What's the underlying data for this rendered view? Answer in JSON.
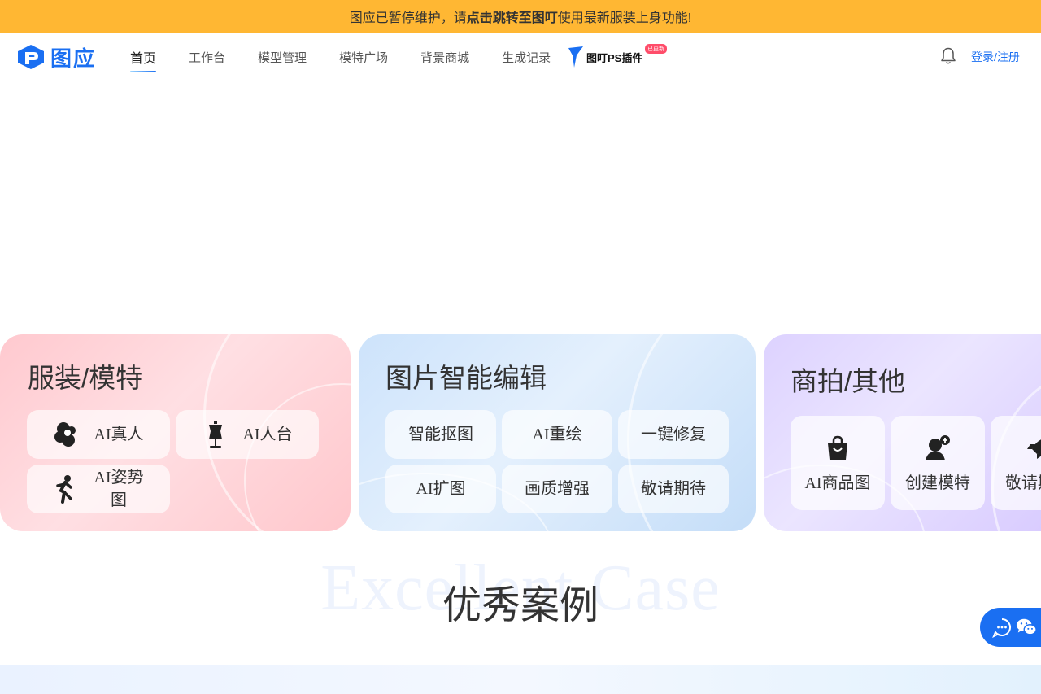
{
  "banner": {
    "text_before": "图应已暂停维护，请",
    "link_text": "点击跳转至图叮",
    "text_after": "使用最新服装上身功能!"
  },
  "header": {
    "logo_text": "图应",
    "nav": [
      {
        "label": "首页",
        "active": true
      },
      {
        "label": "工作台"
      },
      {
        "label": "模型管理"
      },
      {
        "label": "模特广场"
      },
      {
        "label": "背景商城"
      },
      {
        "label": "生成记录"
      }
    ],
    "plugin_label": "图叮PS插件",
    "plugin_badge": "已更新",
    "login_label": "登录/注册",
    "bell_icon": "bell-icon"
  },
  "cards": {
    "apparel": {
      "title": "服装/模特",
      "items": [
        {
          "label": "AI真人",
          "icon": "curly-hair-woman-icon"
        },
        {
          "label": "AI人台",
          "icon": "mannequin-icon"
        },
        {
          "label": "AI姿势图",
          "icon": "running-pose-icon"
        }
      ]
    },
    "edit": {
      "title": "图片智能编辑",
      "items": [
        {
          "label": "智能抠图"
        },
        {
          "label": "AI重绘"
        },
        {
          "label": "一键修复"
        },
        {
          "label": "AI扩图"
        },
        {
          "label": "画质增强"
        },
        {
          "label": "敬请期待"
        }
      ]
    },
    "commerce": {
      "title": "商拍/其他",
      "items": [
        {
          "label": "AI商品图",
          "icon": "shopping-bag-icon"
        },
        {
          "label": "创建模特",
          "icon": "add-person-icon"
        },
        {
          "label": "敬请期待",
          "icon": "rocket-icon"
        }
      ]
    }
  },
  "section": {
    "bg_text": "Excellent Case",
    "title": "优秀案例"
  },
  "colors": {
    "banner": "#ffb733",
    "brand": "#1a6ff2"
  }
}
